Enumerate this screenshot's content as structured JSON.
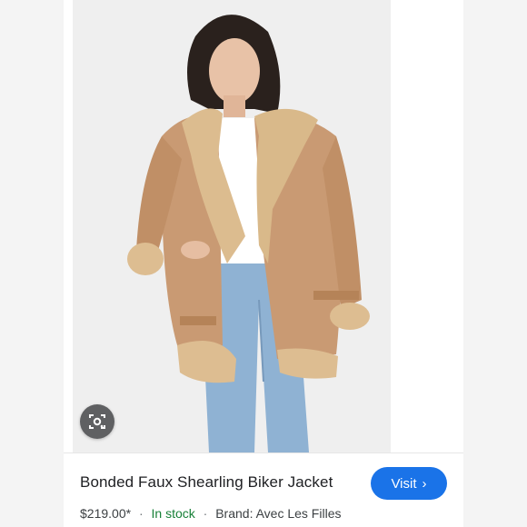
{
  "product": {
    "title": "Bonded Faux Shearling Biker Jacket",
    "price": "$219.00*",
    "separator": "·",
    "availability": "In stock",
    "brand": "Brand: Avec Les Filles"
  },
  "actions": {
    "visit_label": "Visit",
    "visit_icon": "chevron-right-icon",
    "lens_icon": "camera-search-icon"
  },
  "colors": {
    "accent": "#1a73e8",
    "in_stock": "#188038"
  }
}
